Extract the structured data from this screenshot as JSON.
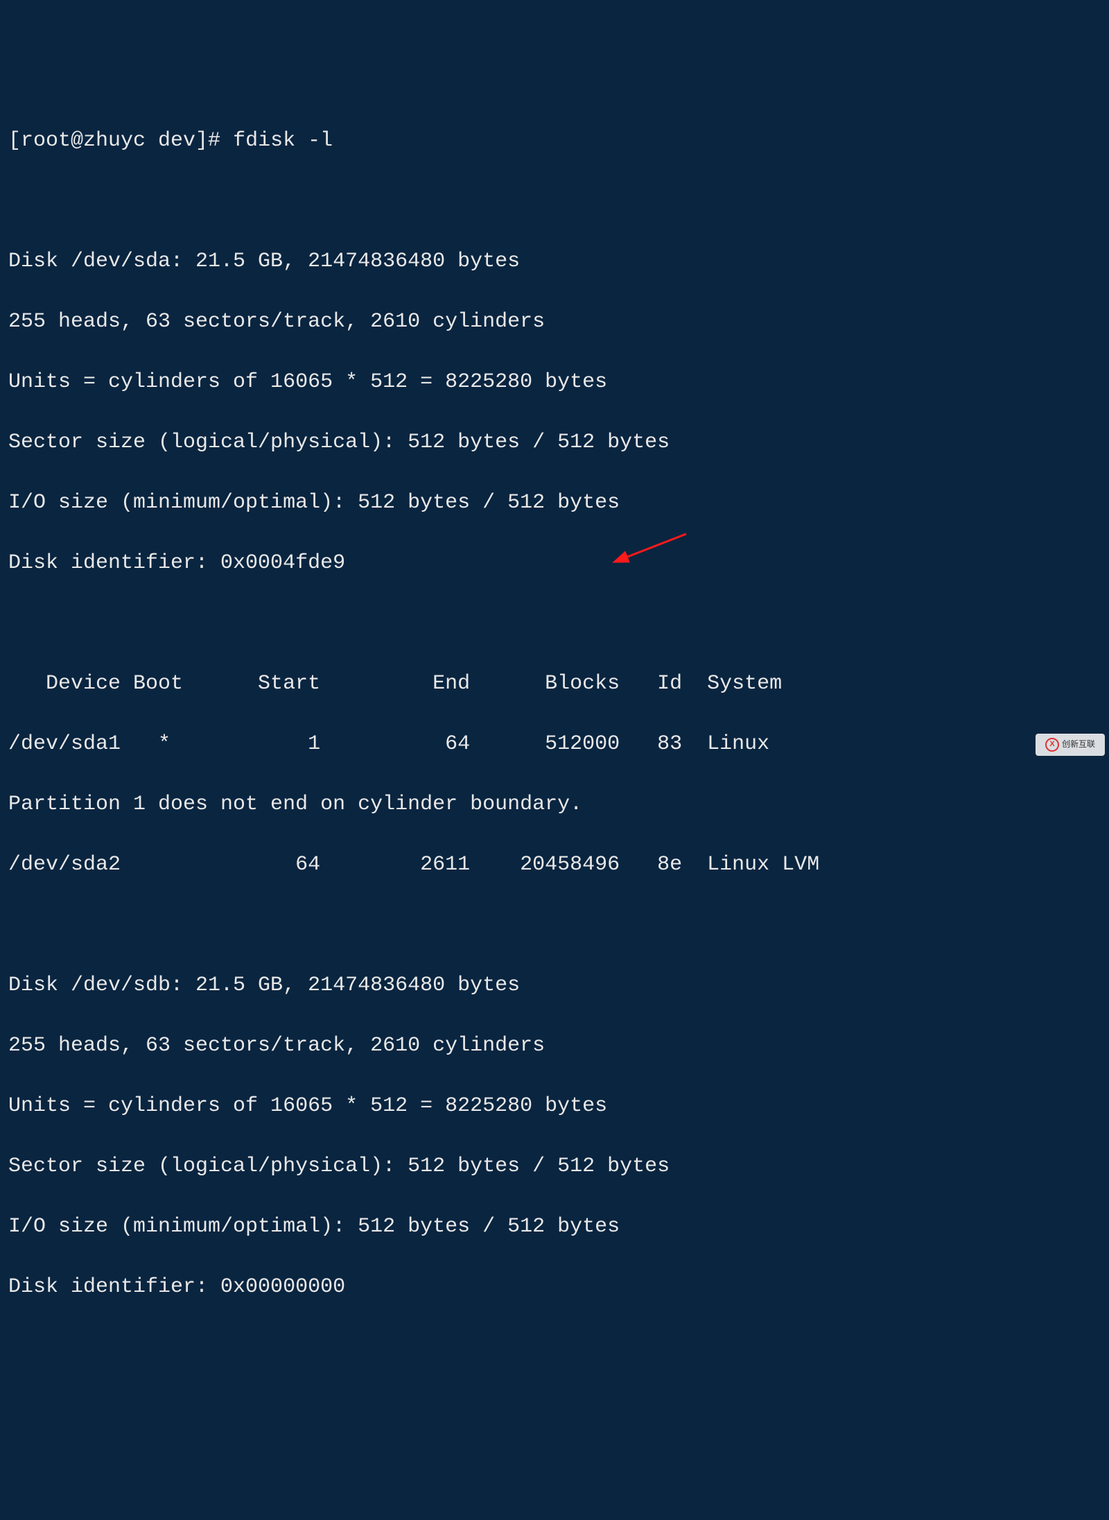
{
  "prompt": "[root@zhuyc dev]# ",
  "command": "fdisk -l",
  "disk_a": {
    "header": "Disk /dev/sda: 21.5 GB, 21474836480 bytes",
    "geom": "255 heads, 63 sectors/track, 2610 cylinders",
    "units": "Units = cylinders of 16065 * 512 = 8225280 bytes",
    "sector": "Sector size (logical/physical): 512 bytes / 512 bytes",
    "io": "I/O size (minimum/optimal): 512 bytes / 512 bytes",
    "ident": "Disk identifier: 0x0004fde9"
  },
  "table": {
    "header": "   Device Boot      Start         End      Blocks   Id  System",
    "row1": "/dev/sda1   *           1          64      512000   83  Linux",
    "warn": "Partition 1 does not end on cylinder boundary.",
    "row2": "/dev/sda2              64        2611    20458496   8e  Linux LVM"
  },
  "disk_b": {
    "header": "Disk /dev/sdb: 21.5 GB, 21474836480 bytes",
    "geom": "255 heads, 63 sectors/track, 2610 cylinders",
    "units": "Units = cylinders of 16065 * 512 = 8225280 bytes",
    "sector": "Sector size (logical/physical): 512 bytes / 512 bytes",
    "io": "I/O size (minimum/optimal): 512 bytes / 512 bytes",
    "ident": "Disk identifier: 0x00000000"
  },
  "watermark": {
    "logo_letter": "X",
    "text": "创新互联"
  }
}
